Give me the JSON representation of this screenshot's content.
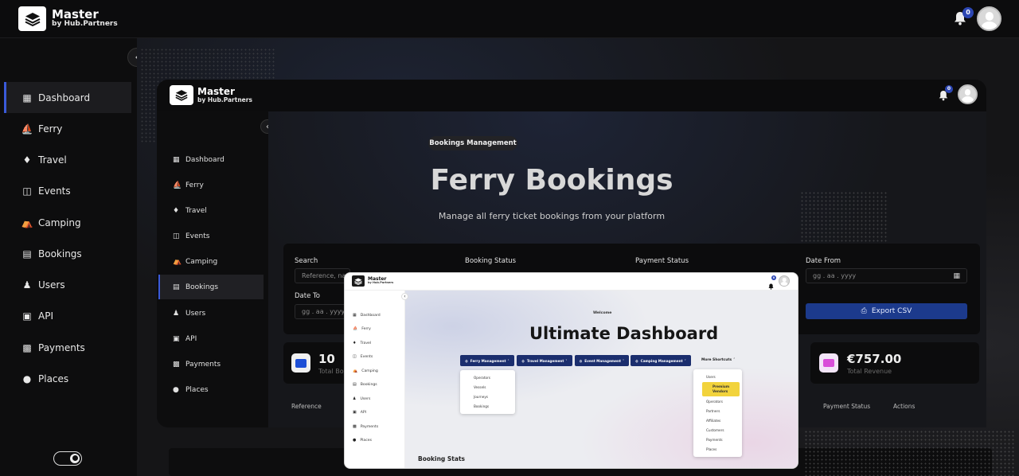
{
  "app": {
    "title": "Master",
    "subtitle": "by Hub.Partners",
    "notifications_count": "0"
  },
  "sidebar": {
    "items": [
      {
        "label": "Dashboard",
        "icon": "dashboard-icon",
        "active": true
      },
      {
        "label": "Ferry",
        "icon": "ferry-icon"
      },
      {
        "label": "Travel",
        "icon": "travel-icon"
      },
      {
        "label": "Events",
        "icon": "events-icon"
      },
      {
        "label": "Camping",
        "icon": "camping-icon"
      },
      {
        "label": "Bookings",
        "icon": "bookings-icon"
      },
      {
        "label": "Users",
        "icon": "users-icon"
      },
      {
        "label": "API",
        "icon": "api-icon"
      },
      {
        "label": "Payments",
        "icon": "payments-icon"
      },
      {
        "label": "Places",
        "icon": "places-icon"
      }
    ]
  },
  "inner": {
    "app": {
      "title": "Master",
      "subtitle": "by Hub.Partners",
      "notifications_count": "0"
    },
    "sidebar": {
      "items": [
        {
          "label": "Dashboard"
        },
        {
          "label": "Ferry"
        },
        {
          "label": "Travel"
        },
        {
          "label": "Events"
        },
        {
          "label": "Camping"
        },
        {
          "label": "Bookings",
          "active": true
        },
        {
          "label": "Users"
        },
        {
          "label": "API"
        },
        {
          "label": "Payments"
        },
        {
          "label": "Places"
        }
      ]
    },
    "breadcrumb": "Bookings Management",
    "page_title": "Ferry Bookings",
    "page_subtitle": "Manage all ferry ticket bookings from your platform",
    "filters": {
      "search_label": "Search",
      "search_placeholder": "Reference, nar",
      "booking_status_label": "Booking Status",
      "payment_status_label": "Payment Status",
      "date_from_label": "Date From",
      "date_from_placeholder": "gg . aa . yyyy",
      "date_to_label": "Date To",
      "date_to_placeholder": "gg . aa . yyyy",
      "export_label": "Export CSV"
    },
    "stats": {
      "total_bookings_value": "10",
      "total_bookings_label": "Total Bo",
      "total_revenue_value": "€757.00",
      "total_revenue_label": "Total Revenue"
    },
    "table_headers": {
      "reference": "Reference",
      "payment_status": "Payment Status",
      "actions": "Actions"
    }
  },
  "inner2": {
    "app": {
      "title": "Master",
      "subtitle": "by Hub.Partners",
      "notifications_count": "0"
    },
    "sidebar": {
      "items": [
        {
          "label": "Dashboard"
        },
        {
          "label": "Ferry"
        },
        {
          "label": "Travel"
        },
        {
          "label": "Events"
        },
        {
          "label": "Camping"
        },
        {
          "label": "Bookings"
        },
        {
          "label": "Users"
        },
        {
          "label": "API"
        },
        {
          "label": "Payments"
        },
        {
          "label": "Places"
        }
      ]
    },
    "welcome": "Welcome",
    "title": "Ultimate Dashboard",
    "menu_buttons": [
      "Ferry Management",
      "Travel Management",
      "Event Management",
      "Camping Management"
    ],
    "more_shortcuts": "More Shortcuts",
    "ferry_dropdown": [
      "Operators",
      "Vessels",
      "Journeys",
      "Bookings"
    ],
    "shortcuts_dropdown": {
      "users": "Users",
      "premium": "Premium Vendors",
      "items": [
        "Operators",
        "Partners",
        "Affiliates",
        "Customers"
      ],
      "payments": "Payments",
      "places": "Places"
    },
    "booking_stats": "Booking Stats"
  },
  "colors": {
    "accent": "#2c46b3",
    "export": "#1c3a8c",
    "premium": "#f2d33c",
    "revenue_icon": "#d94fd9",
    "bookings_icon": "#1d4fd6"
  }
}
